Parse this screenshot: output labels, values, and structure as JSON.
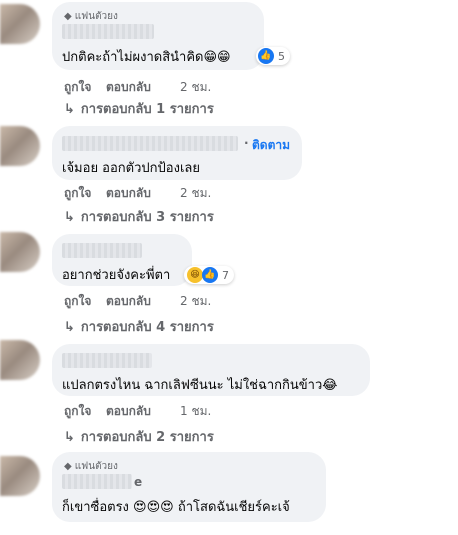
{
  "comments": [
    {
      "badge": "แฟนตัวยง",
      "text": "ปกติคะถ้าไม่ผงาดสินำคิด",
      "emojis": "😁😁",
      "reaction_count": "5",
      "like_label": "ถูกใจ",
      "reply_label": "ตอบกลับ",
      "time": "2 ชม.",
      "replies": "การตอบกลับ 1 รายการ"
    },
    {
      "name_suffix": "·",
      "follow_label": "ติดตาม",
      "text": "เจ้มอย ออกตัวปกป้องเลย",
      "like_label": "ถูกใจ",
      "reply_label": "ตอบกลับ",
      "time": "2 ชม.",
      "replies": "การตอบกลับ 3 รายการ"
    },
    {
      "text": "อยากช่วยจังคะพี่ตา",
      "reaction_count": "7",
      "like_label": "ถูกใจ",
      "reply_label": "ตอบกลับ",
      "time": "2 ชม.",
      "replies": "การตอบกลับ 4 รายการ"
    },
    {
      "text": "แปลกตรงไหน ฉากเลิฟซีนนะ ไม่ใช่ฉากกินข้าว",
      "emojis": "😂",
      "like_label": "ถูกใจ",
      "reply_label": "ตอบกลับ",
      "time": "1 ชม.",
      "replies": "การตอบกลับ 2 รายการ"
    },
    {
      "badge": "แฟนตัวยง",
      "name_tail": "e",
      "text_before": "ก็เขาซื่อตรง",
      "emojis": "😍😍😍",
      "text_after": "ถ้าโสดฉันเชียร์คะเจ้"
    }
  ],
  "icons": {
    "badge": "diamond-icon",
    "reply_arrow": "reply-arrow-icon",
    "like_reaction": "like-reaction-icon",
    "haha_reaction": "haha-reaction-icon"
  },
  "colors": {
    "bubble": "#f0f2f5",
    "secondary_text": "#65676b",
    "link_blue": "#1877f2"
  }
}
